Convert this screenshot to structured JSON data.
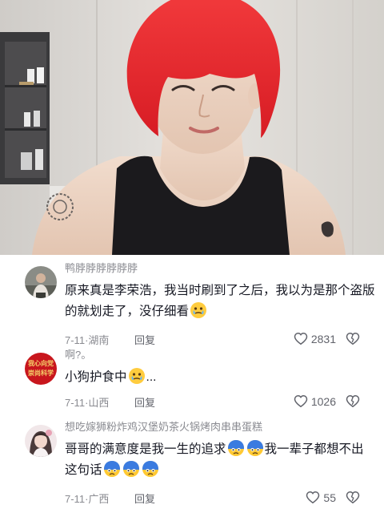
{
  "comments": [
    {
      "nickname": "鸭脖脖脖脖脖脖",
      "text_a": "原来真是李荣浩，我当时刷到了之后，我以为是那个盗版的就划走了，没仔细看",
      "date": "7-11",
      "location": "湖南",
      "reply_label": "回复",
      "likes": "2831",
      "avatar_icon": "person-photo",
      "emoji_icons": [
        "teary-face-emoji"
      ]
    },
    {
      "nickname": "啊?。",
      "avatar_text_line1": "我心向党",
      "avatar_text_line2": "崇尚科学",
      "text_a": "小狗护食中",
      "text_b": "...",
      "date": "7-11",
      "location": "山西",
      "reply_label": "回复",
      "likes": "1026",
      "emoji_icons": [
        "teary-face-emoji"
      ]
    },
    {
      "nickname": "想吃嫁狮粉炸鸡汉堡奶茶火锅烤肉串串蛋糕",
      "text_a": "哥哥的满意度是我一生的追求",
      "text_b": "我一辈子都想不出这句话",
      "date": "7-11",
      "location": "广西",
      "reply_label": "回复",
      "likes": "55",
      "avatar_icon": "girl-photo",
      "emoji_icons": [
        "crying-face-emoji",
        "crying-face-emoji",
        "crying-face-emoji",
        "crying-face-emoji",
        "crying-face-emoji"
      ]
    }
  ],
  "colors": {
    "hair": "#e8262c",
    "nickname": "#8a8b91",
    "text": "#161823",
    "meta": "#8a8b91",
    "avatar_red": "#c8161d",
    "avatar_gold": "#f6d36b"
  }
}
